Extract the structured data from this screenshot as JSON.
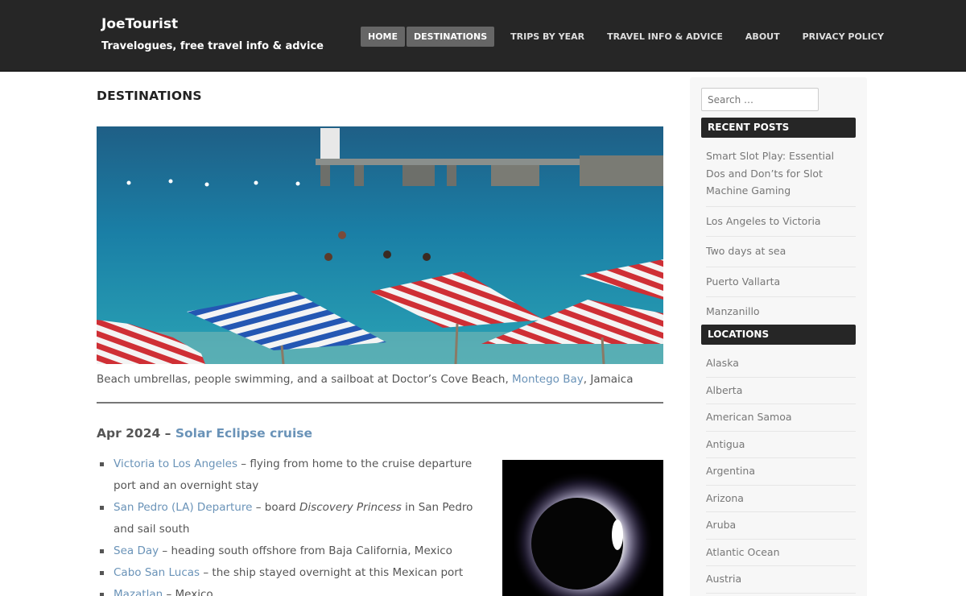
{
  "header": {
    "site_title": "JoeTourist",
    "site_description": "Travelogues, free travel info & advice",
    "nav": [
      "HOME",
      "DESTINATIONS",
      "TRIPS BY YEAR",
      "TRAVEL INFO & ADVICE",
      "ABOUT",
      "PRIVACY POLICY"
    ]
  },
  "main": {
    "page_title": "DESTINATIONS",
    "hero_caption_before": "Beach umbrellas, people swimming, and a sailboat at Doctor’s Cove Beach, ",
    "hero_caption_link": "Montego Bay",
    "hero_caption_after": ", Jamaica",
    "post_date": "Apr 2024 – ",
    "post_link": "Solar Eclipse cruise",
    "trips": [
      {
        "link": "Victoria to Los Angeles",
        "pre_em": " – flying from home to the cruise departure port and an overnight stay",
        "em": "",
        "post_em": ""
      },
      {
        "link": "San Pedro (LA) Departure",
        "pre_em": " – board ",
        "em": "Discovery Princess",
        "post_em": " in San Pedro and sail south"
      },
      {
        "link": "Sea Day",
        "pre_em": " – heading south offshore from Baja California, Mexico",
        "em": "",
        "post_em": ""
      },
      {
        "link": "Cabo San Lucas",
        "pre_em": " – the ship stayed overnight at this Mexican port",
        "em": "",
        "post_em": ""
      },
      {
        "link": "Mazatlan",
        "pre_em": " – Mexico",
        "em": "",
        "post_em": ""
      }
    ]
  },
  "sidebar": {
    "search_placeholder": "Search …",
    "recent_posts_title": "RECENT POSTS",
    "recent_posts": [
      "Smart Slot Play: Essential Dos and Don’ts for Slot Machine Gaming",
      "Los Angeles to Victoria",
      "Two days at sea",
      "Puerto Vallarta",
      "Manzanillo"
    ],
    "locations_title": "LOCATIONS",
    "locations": [
      "Alaska",
      "Alberta",
      "American Samoa",
      "Antigua",
      "Argentina",
      "Arizona",
      "Aruba",
      "Atlantic Ocean",
      "Austria"
    ]
  },
  "colors": {
    "header_bg": "#262626",
    "link": "#6a93b8",
    "nav_active_bg": "#666666",
    "widget_title_bg": "#262626"
  }
}
